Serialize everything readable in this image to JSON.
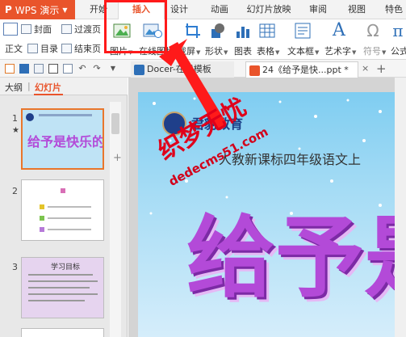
{
  "app": {
    "name": "WPS 演示",
    "accent": "#e9542b"
  },
  "menu": {
    "tabs": [
      {
        "label": "开始"
      },
      {
        "label": "插入",
        "active": true
      },
      {
        "label": "设计"
      },
      {
        "label": "动画"
      },
      {
        "label": "幻灯片放映"
      },
      {
        "label": "审阅"
      },
      {
        "label": "视图"
      },
      {
        "label": "特色"
      }
    ]
  },
  "ribbon": {
    "left_labels": [
      "正文",
      "封面",
      "目录",
      "过渡页",
      "结束页"
    ],
    "buttons": [
      {
        "label": "图片"
      },
      {
        "label": "在线图片"
      },
      {
        "label": "截屏"
      },
      {
        "label": "形状"
      },
      {
        "label": "图表"
      },
      {
        "label": "表格"
      },
      {
        "label": "文本框"
      },
      {
        "label": "艺术字"
      },
      {
        "label": "符号"
      },
      {
        "label": "公式"
      }
    ]
  },
  "doc_tabs": [
    {
      "label": "Docer-在线模板"
    },
    {
      "label": "24《给予是快...ppt *"
    }
  ],
  "left_panel": {
    "tab_outline": "大纲",
    "tab_separator": "|",
    "tab_slides": "幻灯片",
    "slide_numbers": [
      "1",
      "2",
      "3"
    ],
    "thumb1_title": "给予是快乐的",
    "thumb3_title": "学习目标"
  },
  "slide": {
    "school": "君豹教育",
    "subtitle": "人教新课标四年级语文上",
    "title": "给予是快乐的"
  },
  "watermark": {
    "text": "织梦无忧",
    "url": "dedecms51.com"
  }
}
